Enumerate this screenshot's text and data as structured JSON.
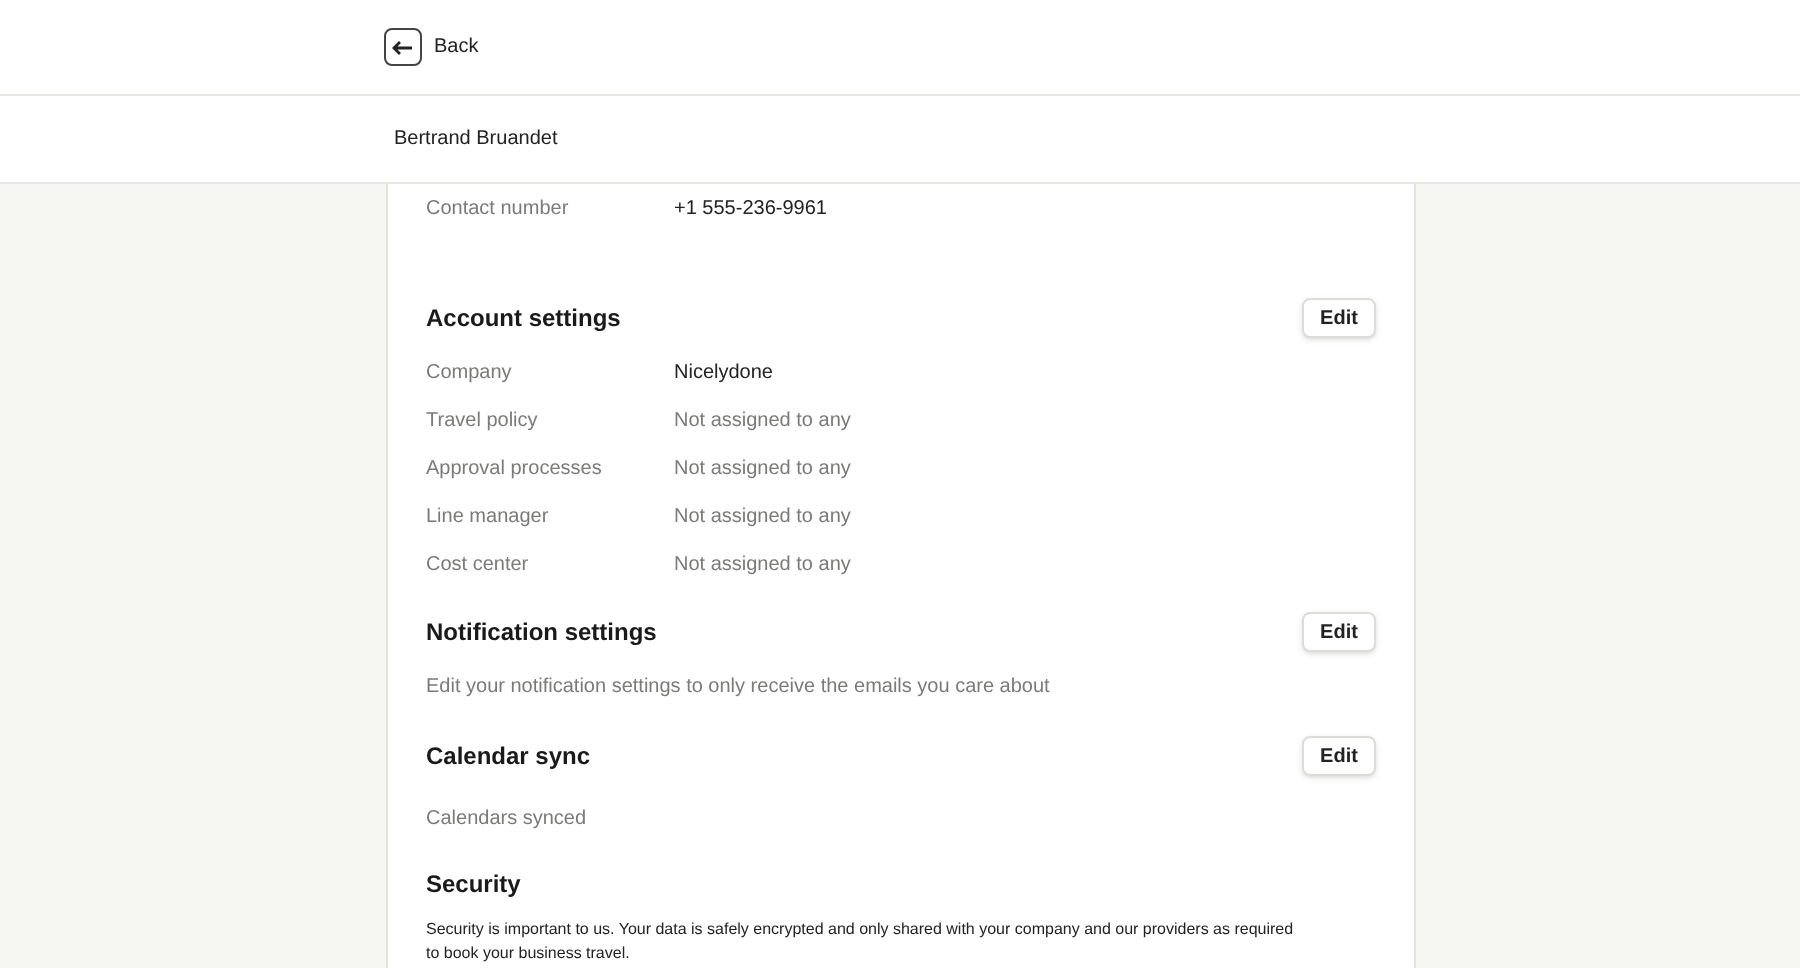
{
  "back_button": {
    "label": "Back"
  },
  "user_name": "Bertrand Bruandet",
  "contact_fields": [
    {
      "label": "Contact number",
      "value": "+1 555-236-9961",
      "assigned": true
    }
  ],
  "sections": [
    {
      "kind": "fields",
      "title": "Account settings",
      "edit_button": "Edit",
      "fields": [
        {
          "label": "Company",
          "value": "Nicelydone",
          "assigned": true
        },
        {
          "label": "Travel policy",
          "value": "Not assigned to any",
          "assigned": false
        },
        {
          "label": "Approval processes",
          "value": "Not assigned to any",
          "assigned": false
        },
        {
          "label": "Line manager",
          "value": "Not assigned to any",
          "assigned": false
        },
        {
          "label": "Cost center",
          "value": "Not assigned to any",
          "assigned": false
        }
      ]
    },
    {
      "kind": "text",
      "title": "Notification settings",
      "edit_button": "Edit",
      "text": "Edit your notification settings to only receive the emails you care about"
    },
    {
      "kind": "text",
      "title": "Calendar sync",
      "edit_button": "Edit",
      "text": "Calendars synced"
    },
    {
      "kind": "note",
      "title": "Security",
      "text": "Security is important to us. Your data is safely encrypted and only shared with your company and our providers as required to book your business travel."
    }
  ]
}
